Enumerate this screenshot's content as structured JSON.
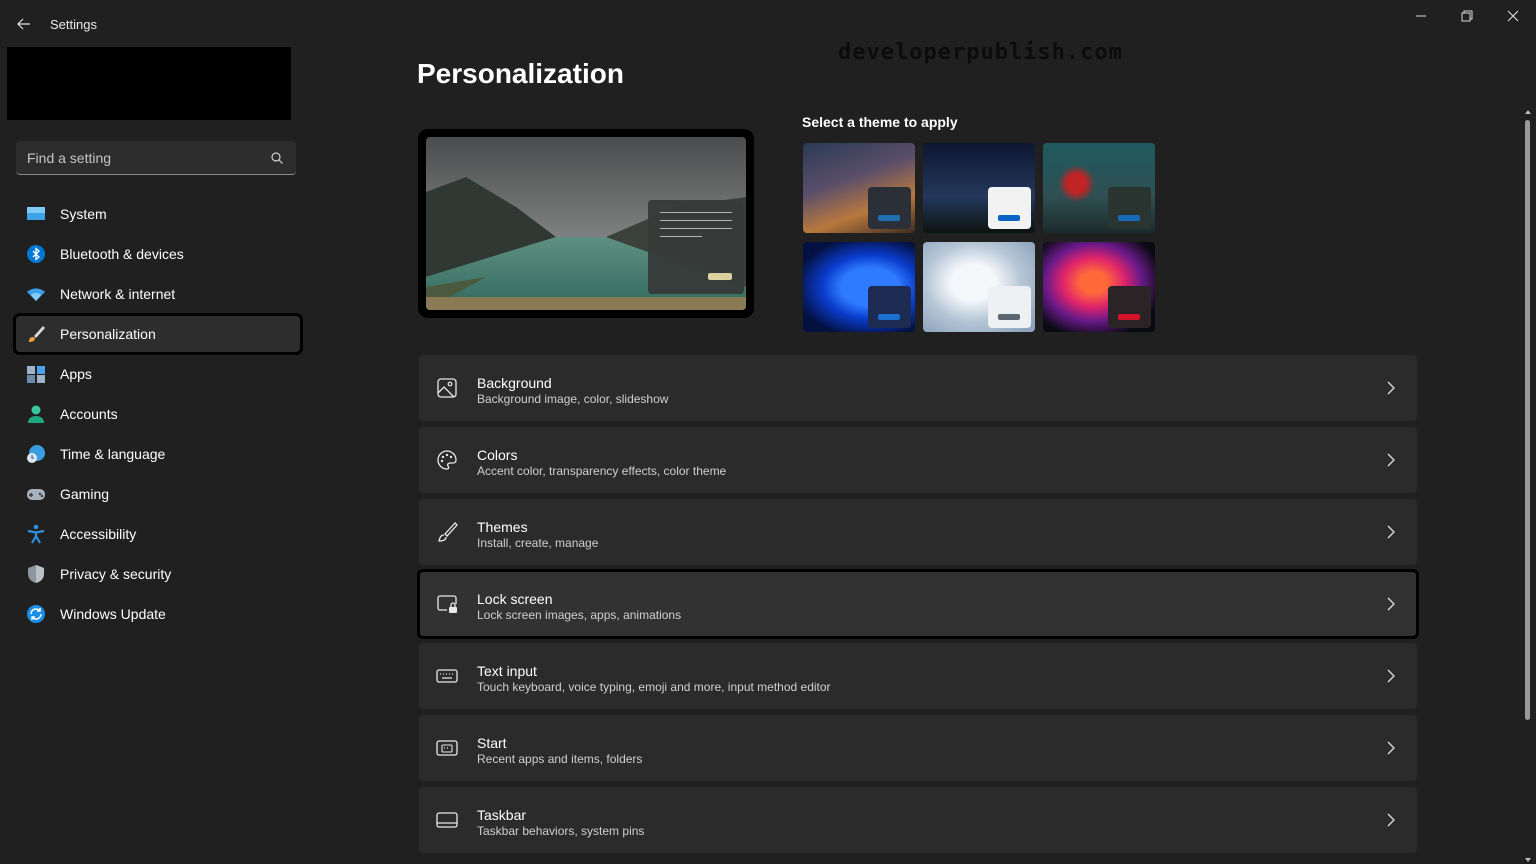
{
  "window": {
    "title": "Settings",
    "back_icon": "arrow-left-icon",
    "controls": [
      "minimize-icon",
      "restore-icon",
      "close-icon"
    ]
  },
  "search": {
    "placeholder": "Find a setting",
    "icon": "search-icon"
  },
  "sidebar": {
    "items": [
      {
        "label": "System",
        "icon": "monitor-icon",
        "active": false
      },
      {
        "label": "Bluetooth & devices",
        "icon": "bluetooth-icon",
        "active": false
      },
      {
        "label": "Network & internet",
        "icon": "wifi-icon",
        "active": false
      },
      {
        "label": "Personalization",
        "icon": "brush-icon",
        "active": true
      },
      {
        "label": "Apps",
        "icon": "apps-icon",
        "active": false
      },
      {
        "label": "Accounts",
        "icon": "person-icon",
        "active": false
      },
      {
        "label": "Time & language",
        "icon": "globe-clock-icon",
        "active": false
      },
      {
        "label": "Gaming",
        "icon": "gamepad-icon",
        "active": false
      },
      {
        "label": "Accessibility",
        "icon": "accessibility-icon",
        "active": false
      },
      {
        "label": "Privacy & security",
        "icon": "shield-icon",
        "active": false
      },
      {
        "label": "Windows Update",
        "icon": "sync-icon",
        "active": false
      }
    ]
  },
  "main": {
    "title": "Personalization",
    "watermark": "developerpublish.com",
    "theme_section_label": "Select a theme to apply",
    "themes": [
      {
        "name": "night-sky-theme",
        "accent": "#1f6fb2"
      },
      {
        "name": "starry-forest-theme",
        "accent": "#0a63c9"
      },
      {
        "name": "rain-glass-theme",
        "accent": "#1669b5"
      },
      {
        "name": "windows-bloom-dark-theme",
        "accent": "#1a6fd0"
      },
      {
        "name": "windows-bloom-light-theme",
        "accent": "#5c6670"
      },
      {
        "name": "captured-motion-theme",
        "accent": "#d2142a"
      }
    ],
    "cards": [
      {
        "title": "Background",
        "subtitle": "Background image, color, slideshow",
        "icon": "image-icon"
      },
      {
        "title": "Colors",
        "subtitle": "Accent color, transparency effects, color theme",
        "icon": "palette-icon"
      },
      {
        "title": "Themes",
        "subtitle": "Install, create, manage",
        "icon": "brush-icon"
      },
      {
        "title": "Lock screen",
        "subtitle": "Lock screen images, apps, animations",
        "icon": "lock-screen-icon"
      },
      {
        "title": "Text input",
        "subtitle": "Touch keyboard, voice typing, emoji and more, input method editor",
        "icon": "keyboard-icon"
      },
      {
        "title": "Start",
        "subtitle": "Recent apps and items, folders",
        "icon": "start-menu-icon"
      },
      {
        "title": "Taskbar",
        "subtitle": "Taskbar behaviors, system pins",
        "icon": "taskbar-icon"
      }
    ]
  },
  "colors": {
    "background": "#202020",
    "card": "#2b2b2b",
    "accent": "#0078d4"
  }
}
